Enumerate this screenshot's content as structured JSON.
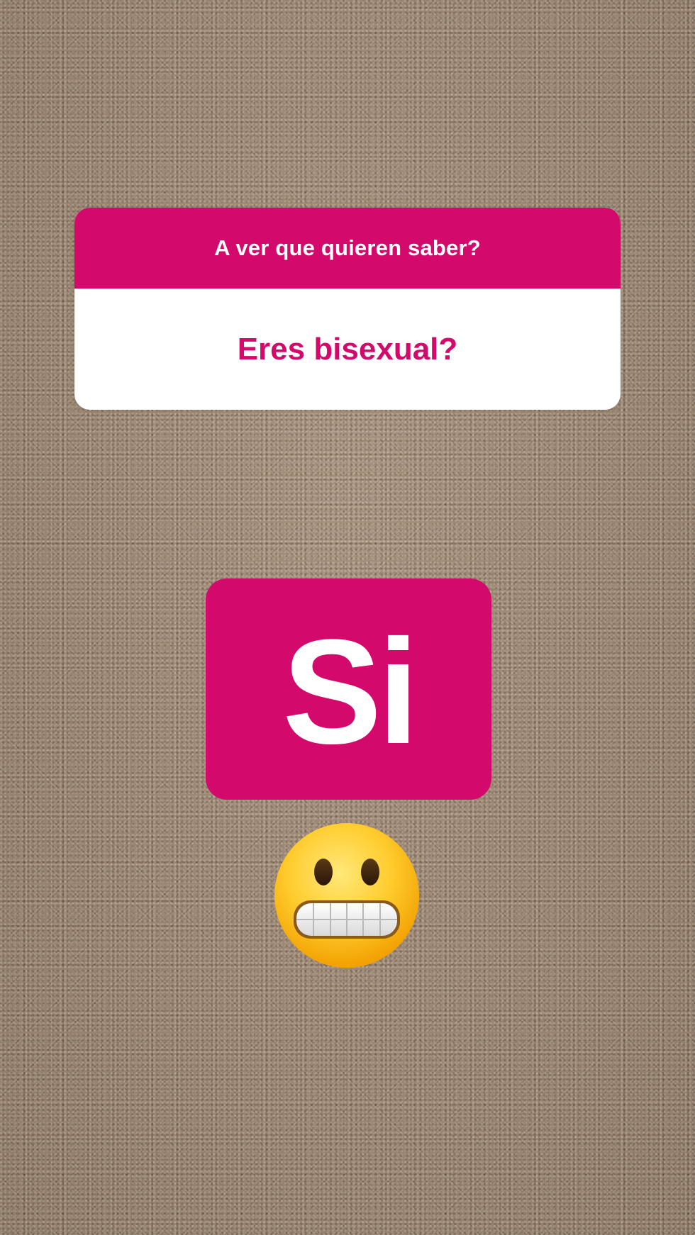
{
  "colors": {
    "accent": "#d30a6b",
    "background": "#a08a74",
    "card": "#ffffff"
  },
  "question_sticker": {
    "prompt": "A ver que quieren saber?",
    "question": "Eres bisexual?"
  },
  "answer_sticker": {
    "text": "Si"
  },
  "emoji": {
    "icon": "grimacing-face-icon"
  }
}
